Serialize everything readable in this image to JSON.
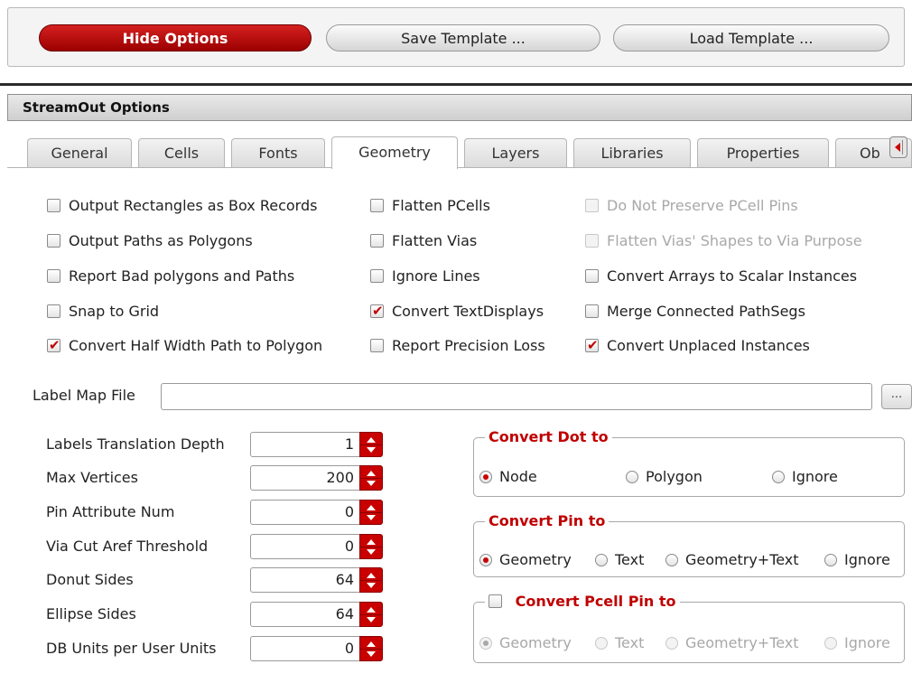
{
  "toolbar": {
    "hide_options": "Hide Options",
    "save_template": "Save Template ...",
    "load_template": "Load Template ..."
  },
  "section_title": "StreamOut Options",
  "tabs": [
    "General",
    "Cells",
    "Fonts",
    "Geometry",
    "Layers",
    "Libraries",
    "Properties",
    "Ob"
  ],
  "active_tab": "Geometry",
  "checkboxes": {
    "col1": [
      {
        "label": "Output Rectangles as Box Records",
        "checked": false
      },
      {
        "label": "Output Paths as Polygons",
        "checked": false
      },
      {
        "label": "Report Bad polygons and Paths",
        "checked": false
      },
      {
        "label": "Snap to Grid",
        "checked": false
      },
      {
        "label": "Convert Half Width Path to Polygon",
        "checked": true
      }
    ],
    "col2": [
      {
        "label": "Flatten PCells",
        "checked": false
      },
      {
        "label": "Flatten Vias",
        "checked": false
      },
      {
        "label": "Ignore Lines",
        "checked": false
      },
      {
        "label": "Convert TextDisplays",
        "checked": true
      },
      {
        "label": "Report Precision Loss",
        "checked": false
      }
    ],
    "col3": [
      {
        "label": "Do Not Preserve PCell Pins",
        "checked": false,
        "disabled": true
      },
      {
        "label": "Flatten Vias' Shapes to Via Purpose",
        "checked": false,
        "disabled": true
      },
      {
        "label": "Convert Arrays to Scalar Instances",
        "checked": false
      },
      {
        "label": "Merge Connected PathSegs",
        "checked": false
      },
      {
        "label": "Convert Unplaced Instances",
        "checked": true
      }
    ]
  },
  "label_map": {
    "label": "Label Map File",
    "value": "",
    "browse": "..."
  },
  "spinners": [
    {
      "label": "Labels Translation Depth",
      "value": "1"
    },
    {
      "label": "Max Vertices",
      "value": "200"
    },
    {
      "label": "Pin Attribute Num",
      "value": "0"
    },
    {
      "label": "Via Cut Aref Threshold",
      "value": "0"
    },
    {
      "label": "Donut Sides",
      "value": "64"
    },
    {
      "label": "Ellipse Sides",
      "value": "64"
    },
    {
      "label": "DB Units per User Units",
      "value": "0"
    }
  ],
  "convert_dot": {
    "title": "Convert Dot to",
    "options": [
      "Node",
      "Polygon",
      "Ignore"
    ],
    "selected": "Node"
  },
  "convert_pin": {
    "title": "Convert Pin to",
    "options": [
      "Geometry",
      "Text",
      "Geometry+Text",
      "Ignore"
    ],
    "selected": "Geometry"
  },
  "convert_pcell_pin": {
    "title": "Convert Pcell Pin to",
    "checked": false,
    "options": [
      "Geometry",
      "Text",
      "Geometry+Text",
      "Ignore"
    ],
    "selected": "Geometry"
  },
  "colors": {
    "accent": "#c80000",
    "disabled_text": "#a8a8a8"
  }
}
